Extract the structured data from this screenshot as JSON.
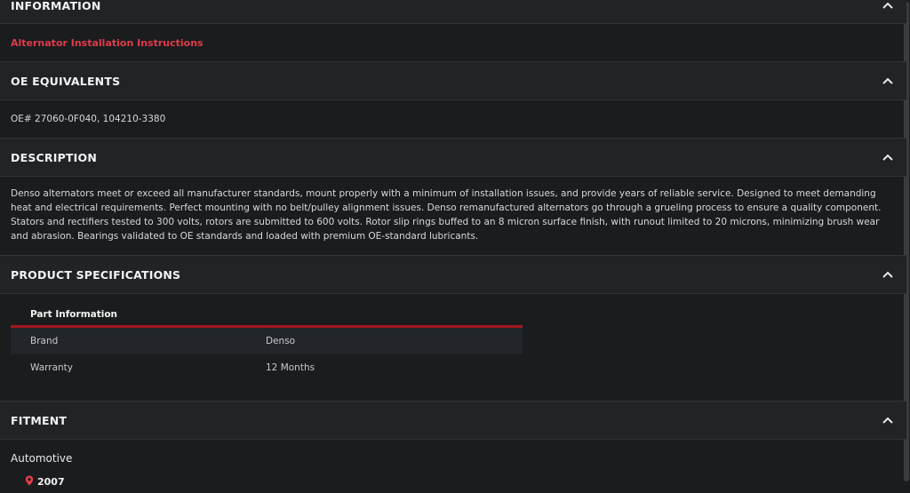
{
  "sections": {
    "information": {
      "title": "INFORMATION",
      "link": "Alternator Installation Instructions"
    },
    "oe": {
      "title": "OE EQUIVALENTS",
      "text": "OE# 27060-0F040, 104210-3380"
    },
    "description": {
      "title": "DESCRIPTION",
      "text": "Denso alternators meet or exceed all manufacturer standards, mount properly with a minimum of installation issues, and provide years of reliable service. Designed to meet demanding heat and electrical requirements. Perfect mounting with no belt/pulley alignment issues. Denso remanufactured alternators go through a grueling process to ensure a quality component. Stators and rectifiers tested to 300 volts, rotors are submitted to 600 volts. Rotor slip rings buffed to an 8 micron surface finish, with runout limited to 20 microns, minimizing brush wear and abrasion. Bearings validated to OE standards and loaded with premium OE-standard lubricants."
    },
    "specs": {
      "title": "PRODUCT SPECIFICATIONS",
      "table_header": "Part Information",
      "rows": [
        {
          "label": "Brand",
          "value": "Denso"
        },
        {
          "label": "Warranty",
          "value": "12 Months"
        }
      ]
    },
    "fitment": {
      "title": "FITMENT",
      "category": "Automotive",
      "year": "2007"
    }
  },
  "colors": {
    "accent": "#e13b4a",
    "divider": "#a3161f"
  },
  "icons": {
    "collapse": "chevron-up-icon",
    "year_marker": "location-pin-icon"
  }
}
